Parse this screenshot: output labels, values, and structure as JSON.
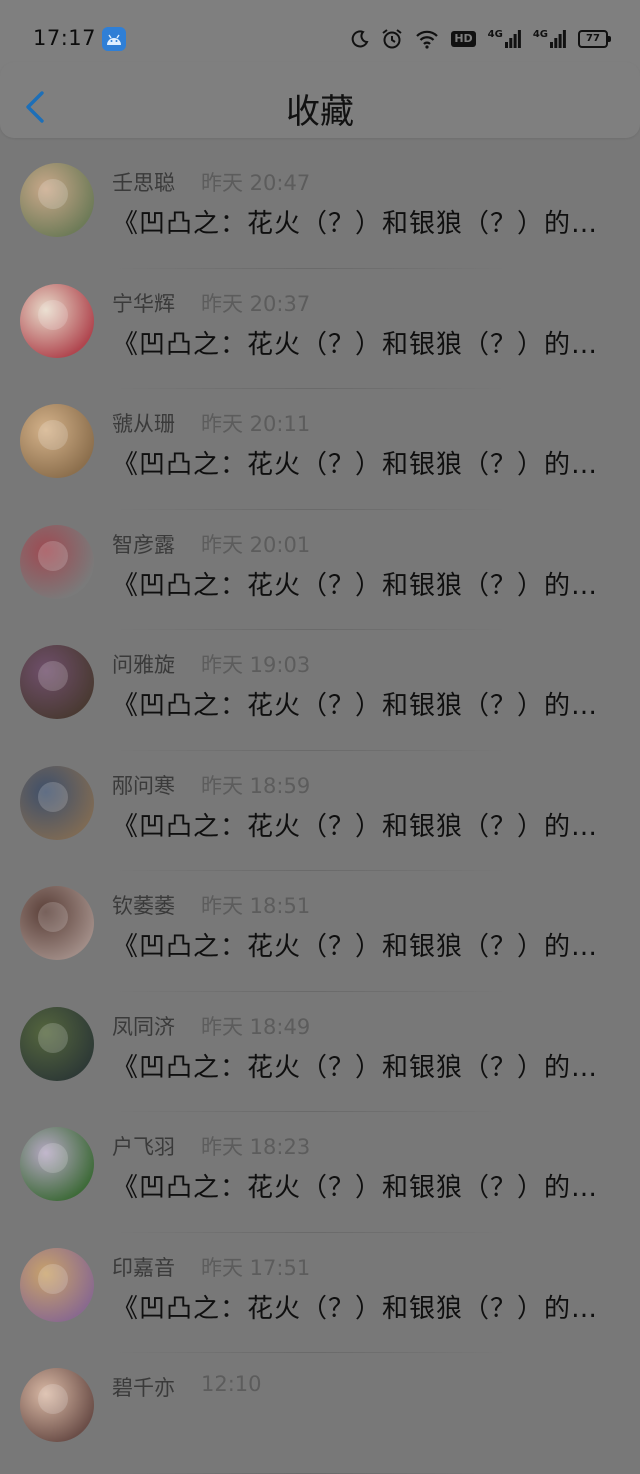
{
  "status_bar": {
    "time": "17:17",
    "hd_label": "HD",
    "net1_label": "4G",
    "net2_label": "4G",
    "battery": "77"
  },
  "navbar": {
    "title": "收藏"
  },
  "favorites": [
    {
      "name": "壬思聪",
      "time": "昨天 20:47",
      "message": "《凹凸之：花火（？）和银狼（？）的故事",
      "avatar_colors": [
        "#6e7b58",
        "#c9a88a"
      ]
    },
    {
      "name": "宁华辉",
      "time": "昨天 20:37",
      "message": "《凹凸之：花火（？）和银狼（？）的故事",
      "avatar_colors": [
        "#b0464f",
        "#e7d9c8"
      ]
    },
    {
      "name": "虢从珊",
      "time": "昨天 20:11",
      "message": "《凹凸之：花火（？）和银狼（？）的故事",
      "avatar_colors": [
        "#8c6f4d",
        "#d4b28a"
      ]
    },
    {
      "name": "智彦露",
      "time": "昨天 20:01",
      "message": "《凹凸之：花火（？）和银狼（？）的故事",
      "avatar_colors": [
        "#7a7a7a",
        "#9e4a52"
      ]
    },
    {
      "name": "问雅旋",
      "time": "昨天 19:03",
      "message": "《凹凸之：花火（？）和银狼（？）的故事",
      "avatar_colors": [
        "#4a3a33",
        "#6f4f6b"
      ]
    },
    {
      "name": "邴问寒",
      "time": "昨天 18:59",
      "message": "《凹凸之：花火（？）和银狼（？）的故事",
      "avatar_colors": [
        "#7d6a55",
        "#3e4f6a"
      ]
    },
    {
      "name": "钦萎萎",
      "time": "昨天 18:51",
      "message": "《凹凸之：花火（？）和银狼（？）的故事",
      "avatar_colors": [
        "#a08c86",
        "#5a3f38"
      ]
    },
    {
      "name": "凤同济",
      "time": "昨天 18:49",
      "message": "《凹凸之：花火（？）和银狼（？）的故事",
      "avatar_colors": [
        "#2e3a36",
        "#55663e"
      ]
    },
    {
      "name": "户飞羽",
      "time": "昨天 18:23",
      "message": "《凹凸之：花火（？）和银狼（？）的故事",
      "avatar_colors": [
        "#3f6b3a",
        "#b5a8c2"
      ]
    },
    {
      "name": "印嘉音",
      "time": "昨天 17:51",
      "message": "《凹凸之：花火（？）和银狼（？）的故事",
      "avatar_colors": [
        "#8a6a8e",
        "#c9a36b"
      ]
    },
    {
      "name": "碧千亦",
      "time": "12:10",
      "message": "",
      "avatar_colors": [
        "#6b4e48",
        "#d9b9a5"
      ]
    }
  ]
}
